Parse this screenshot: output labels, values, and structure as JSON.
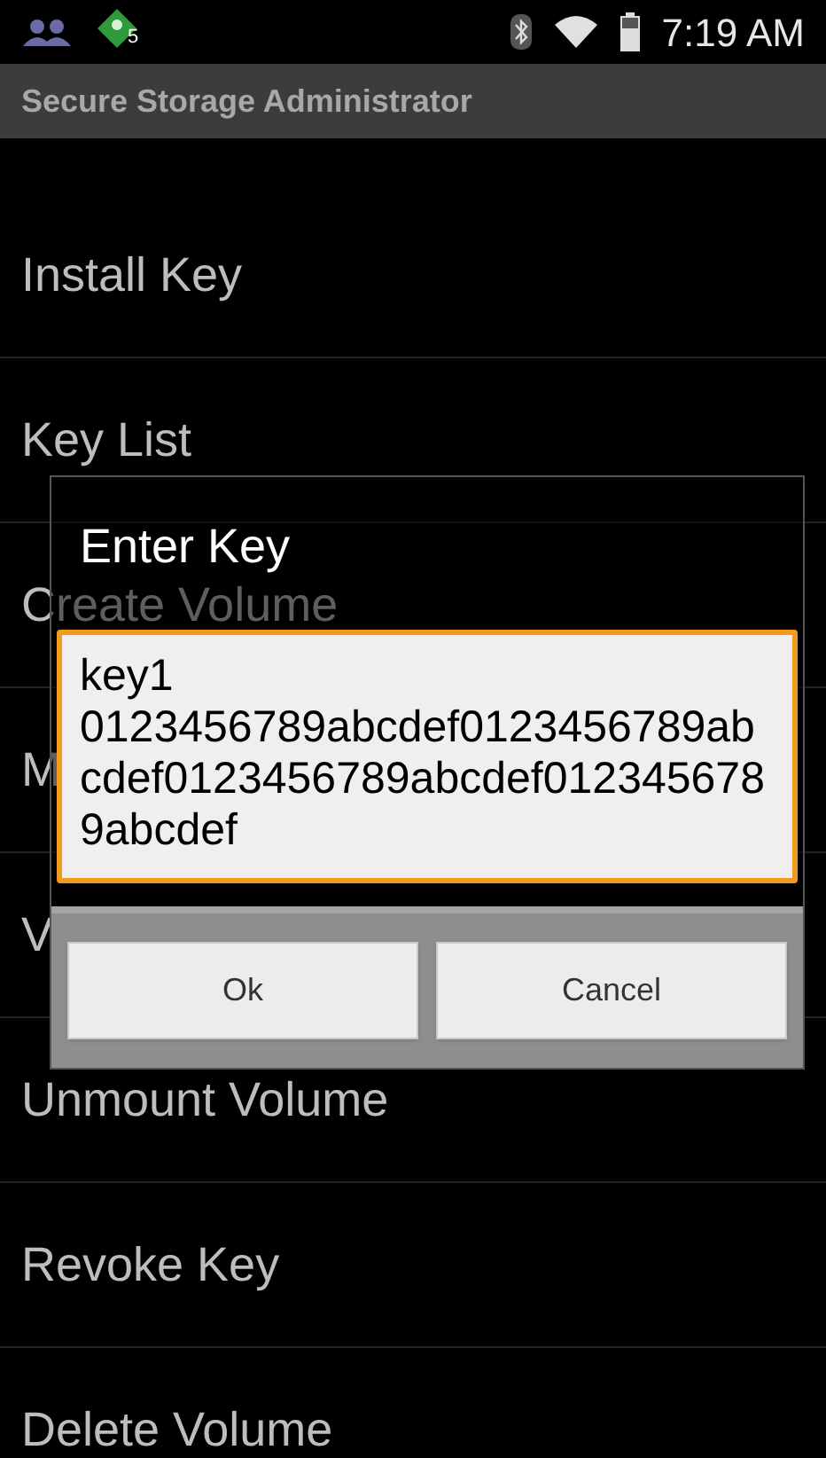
{
  "status_bar": {
    "badge_count": "5",
    "time": "7:19 AM"
  },
  "app_bar": {
    "title": "Secure Storage Administrator"
  },
  "menu": [
    {
      "label": "Install Key"
    },
    {
      "label": "Key List"
    },
    {
      "label": "Create Volume"
    },
    {
      "label": "M"
    },
    {
      "label": "V"
    },
    {
      "label": "Unmount Volume"
    },
    {
      "label": "Revoke Key"
    },
    {
      "label": "Delete Volume"
    }
  ],
  "dialog": {
    "title": "Enter Key",
    "field": {
      "value": "key1\n0123456789abcdef0123456789abcdef0123456789abcdef0123456789abcdef"
    },
    "buttons": [
      "Ok",
      "Cancel"
    ]
  }
}
